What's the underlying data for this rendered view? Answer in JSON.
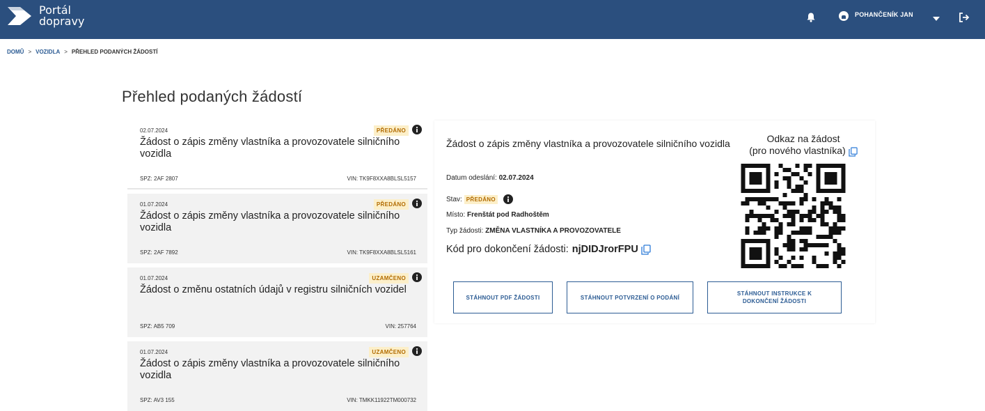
{
  "header": {
    "logo_line1": "Portál",
    "logo_line2": "dopravy",
    "user_name": "POHANČENÍK JAN",
    "bg_color": "#2b4f7e"
  },
  "breadcrumb": {
    "items": [
      "DOMŮ",
      "VOZIDLA"
    ],
    "current": "PŘEHLED PODANÝCH ŽÁDOSTÍ",
    "separator": ">"
  },
  "page": {
    "title": "Přehled podaných žádostí"
  },
  "applications": [
    {
      "date": "02.07.2024",
      "status": "PŘEDÁNO",
      "title": "Žádost o zápis změny vlastníka a provozovatele silničního vozidla",
      "spz": "SPZ: 2AF 2807",
      "vin": "VIN: TK9F8XXA8BLSL5157"
    },
    {
      "date": "01.07.2024",
      "status": "PŘEDÁNO",
      "title": "Žádost o zápis změny vlastníka a provozovatele silničního vozidla",
      "spz": "SPZ: 2AF 7892",
      "vin": "VIN: TK9F8XXA8BLSL5161"
    },
    {
      "date": "01.07.2024",
      "status": "UZAMČENO",
      "title": "Žádost o změnu ostatních údajů v registru silničních vozidel",
      "spz": "SPZ: AB5 709",
      "vin": "VIN: 257764"
    },
    {
      "date": "01.07.2024",
      "status": "UZAMČENO",
      "title": "Žádost o zápis změny vlastníka a provozovatele silničního vozidla",
      "spz": "SPZ: AV3 155",
      "vin": "VIN: TMKK11922TM000732"
    }
  ],
  "detail": {
    "title": "Žádost o zápis změny vlastníka a provozovatele silničního vozidla",
    "sent_label": "Datum odeslání:",
    "sent_value": "02.07.2024",
    "status_label": "Stav:",
    "status_value": "PŘEDÁNO",
    "place_label": "Místo:",
    "place_value": "Frenštát pod Radhoštěm",
    "type_label": "Typ žádosti:",
    "type_value": "ZMĚNA VLASTNÍKA A PROVOZOVATELE",
    "code_label": "Kód pro dokončení žádosti:",
    "code_value": "njDIDJrorFPU",
    "link_heading_line1": "Odkaz na žádost",
    "link_heading_line2": "(pro nového vlastníka)",
    "buttons": {
      "download_pdf": "STÁHNOUT PDF ŽÁDOSTI",
      "download_confirmation": "STÁHNOUT POTVRZENÍ O PODÁNÍ",
      "download_instructions": "STÁHNOUT INSTRUKCE K DOKONČENÍ ŽÁDOSTI"
    }
  },
  "colors": {
    "accent": "#2b5b93",
    "status_text": "#b26b00",
    "status_bg": "#fcefc9"
  }
}
